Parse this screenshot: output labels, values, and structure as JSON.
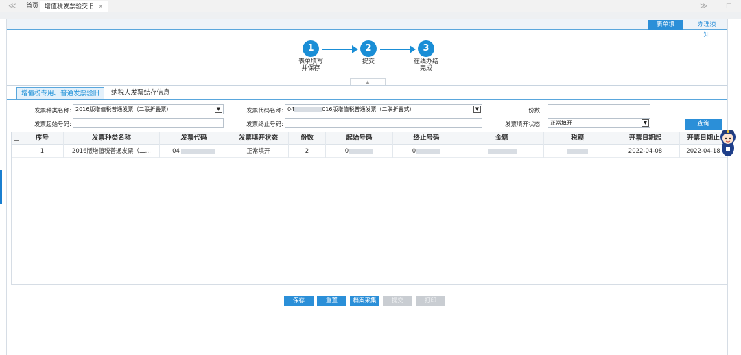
{
  "top_tabs": {
    "back_glyph": "≪",
    "home": "首页",
    "current": "增值税发票验交旧",
    "close_glyph": "×",
    "forward_glyph": "≫",
    "restore_glyph": "□"
  },
  "frame_head": {
    "form_fill": "表单填写",
    "instructions": "办理须知"
  },
  "steps": [
    {
      "number": "1",
      "label_line1": "表单填写",
      "label_line2": "并保存"
    },
    {
      "number": "2",
      "label_line1": "提交",
      "label_line2": ""
    },
    {
      "number": "3",
      "label_line1": "在线办结",
      "label_line2": "完成"
    }
  ],
  "collapse_glyph": "▲",
  "subtabs": {
    "active": "增值税专用、普通发票验旧",
    "other": "纳税人发票结存信息"
  },
  "form": {
    "invoice_type_label": "发票种类名称:",
    "invoice_type_value": "2016版增值税普通发票（二联折叠票）",
    "invoice_code_name_label": "发票代码名称:",
    "invoice_code_name_prefix": "04",
    "invoice_code_name_suffix": "016版增值税普通发票（二联折叠式）",
    "copies_label": "份数:",
    "copies_value": "",
    "start_no_label": "发票起始号码:",
    "start_no_value": "",
    "end_no_label": "发票终止号码:",
    "end_no_value": "",
    "status_label": "发票填开状态:",
    "status_value": "正常填开",
    "query_button": "查询"
  },
  "table": {
    "headers": [
      "序号",
      "发票种类名称",
      "发票代码",
      "发票填开状态",
      "份数",
      "起始号码",
      "终止号码",
      "金额",
      "税额",
      "开票日期起",
      "开票日期止"
    ],
    "rows": [
      {
        "index": "1",
        "type_name": "2016版增值税普通发票（二…",
        "code_prefix": "04",
        "status": "正常填开",
        "copies": "2",
        "start_prefix": "0",
        "end_prefix": "0",
        "date_from": "2022-04-08",
        "date_to": "2022-04-18"
      }
    ]
  },
  "actions": {
    "save": "保存",
    "reset": "重置",
    "archive": "档案采集",
    "submit": "提交",
    "print": "打印"
  },
  "colors": {
    "accent": "#2b8fd8",
    "step": "#1a8ed6",
    "disabled": "#c9cdd2"
  }
}
